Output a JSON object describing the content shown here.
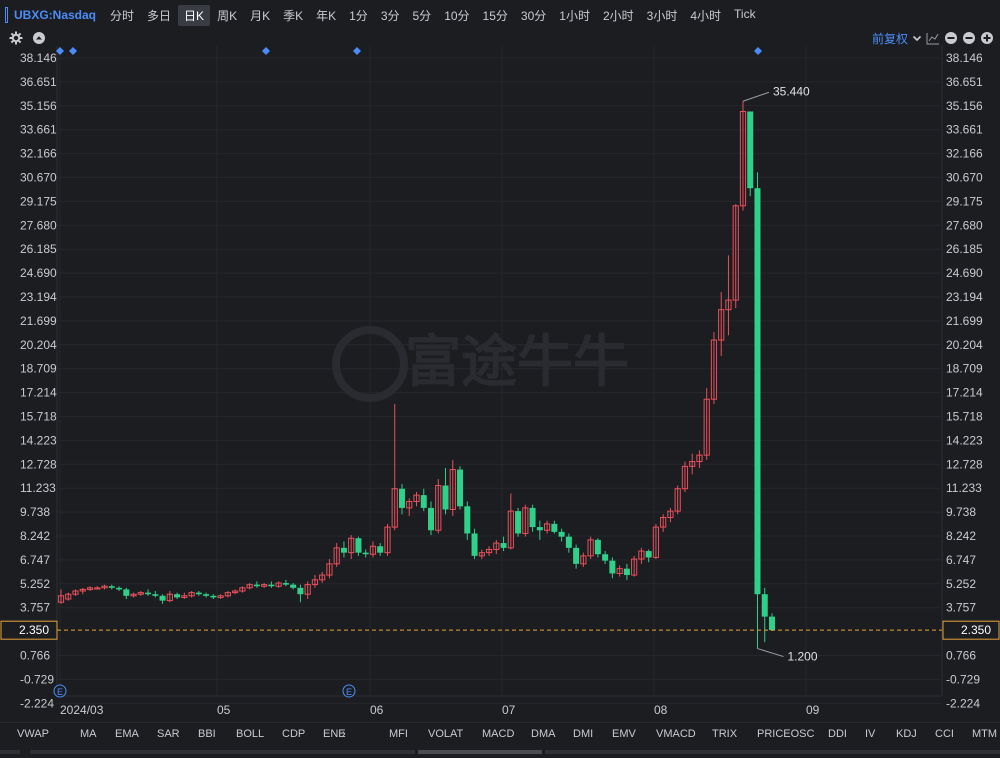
{
  "header": {
    "symbol": "UBXG:Nasdaq",
    "periods": [
      "分时",
      "多日",
      "日K",
      "周K",
      "月K",
      "季K",
      "年K",
      "1分",
      "3分",
      "5分",
      "10分",
      "15分",
      "30分",
      "1小时",
      "2小时",
      "3小时",
      "4小时",
      "Tick"
    ],
    "active_period": "日K"
  },
  "toolbar": {
    "adjust_label": "前复权"
  },
  "watermark": "富途牛牛",
  "price_axis": [
    "38.146",
    "36.651",
    "35.156",
    "33.661",
    "32.166",
    "30.670",
    "29.175",
    "27.680",
    "26.185",
    "24.690",
    "23.194",
    "21.699",
    "20.204",
    "18.709",
    "17.214",
    "15.718",
    "14.223",
    "12.728",
    "11.233",
    "9.738",
    "8.242",
    "6.747",
    "5.252",
    "3.757",
    "2.350",
    "0.766",
    "-0.729",
    "-2.224"
  ],
  "date_axis": [
    "2024/03",
    "05",
    "06",
    "07",
    "08",
    "09"
  ],
  "current_price": "2.350",
  "high_marker": "35.440",
  "low_marker": "1.200",
  "earnings_marker": "E",
  "colors": {
    "up": "#e8505b",
    "down": "#2fd08a",
    "accent": "#4b8df8",
    "price_line": "#e8a33a"
  },
  "chart_data": {
    "type": "candlestick",
    "ohlc": [
      [
        4.1,
        4.9,
        4.0,
        4.5
      ],
      [
        4.3,
        4.7,
        4.2,
        4.6
      ],
      [
        4.6,
        4.9,
        4.5,
        4.8
      ],
      [
        4.8,
        5.0,
        4.6,
        4.9
      ],
      [
        4.9,
        5.1,
        4.8,
        5.0
      ],
      [
        5.0,
        5.1,
        4.9,
        5.0
      ],
      [
        5.0,
        5.2,
        4.9,
        5.1
      ],
      [
        5.1,
        5.2,
        4.9,
        5.0
      ],
      [
        5.0,
        5.1,
        4.8,
        4.9
      ],
      [
        4.9,
        5.0,
        4.3,
        4.5
      ],
      [
        4.5,
        4.7,
        4.4,
        4.6
      ],
      [
        4.6,
        4.8,
        4.5,
        4.7
      ],
      [
        4.7,
        4.9,
        4.5,
        4.6
      ],
      [
        4.6,
        4.8,
        4.4,
        4.5
      ],
      [
        4.5,
        4.6,
        4.0,
        4.2
      ],
      [
        4.2,
        4.8,
        4.1,
        4.6
      ],
      [
        4.6,
        4.7,
        4.3,
        4.4
      ],
      [
        4.4,
        4.7,
        4.3,
        4.5
      ],
      [
        4.5,
        4.8,
        4.4,
        4.7
      ],
      [
        4.7,
        4.8,
        4.5,
        4.6
      ],
      [
        4.6,
        4.7,
        4.4,
        4.5
      ],
      [
        4.5,
        4.6,
        4.3,
        4.4
      ],
      [
        4.4,
        4.6,
        4.3,
        4.5
      ],
      [
        4.5,
        4.8,
        4.4,
        4.7
      ],
      [
        4.7,
        4.9,
        4.6,
        4.8
      ],
      [
        4.8,
        5.1,
        4.7,
        5.0
      ],
      [
        5.0,
        5.3,
        4.9,
        5.2
      ],
      [
        5.2,
        5.4,
        5.0,
        5.1
      ],
      [
        5.1,
        5.3,
        5.0,
        5.2
      ],
      [
        5.2,
        5.4,
        5.0,
        5.1
      ],
      [
        5.1,
        5.4,
        5.0,
        5.3
      ],
      [
        5.3,
        5.5,
        5.1,
        5.2
      ],
      [
        5.2,
        5.3,
        4.9,
        5.0
      ],
      [
        5.0,
        5.2,
        4.1,
        4.6
      ],
      [
        4.6,
        5.4,
        4.3,
        5.2
      ],
      [
        5.2,
        5.8,
        5.0,
        5.5
      ],
      [
        5.5,
        6.0,
        5.3,
        5.8
      ],
      [
        5.8,
        6.8,
        5.6,
        6.5
      ],
      [
        6.5,
        7.8,
        6.3,
        7.5
      ],
      [
        7.5,
        7.9,
        6.9,
        7.2
      ],
      [
        7.2,
        8.3,
        6.8,
        8.1
      ],
      [
        8.1,
        8.2,
        7.0,
        7.2
      ],
      [
        7.2,
        7.4,
        6.9,
        7.1
      ],
      [
        7.1,
        7.9,
        6.9,
        7.6
      ],
      [
        7.6,
        7.8,
        7.0,
        7.2
      ],
      [
        7.2,
        9.0,
        7.0,
        8.8
      ],
      [
        8.8,
        16.5,
        8.6,
        11.2
      ],
      [
        11.2,
        11.5,
        9.6,
        10.0
      ],
      [
        10.0,
        10.6,
        9.5,
        10.4
      ],
      [
        10.4,
        11.0,
        10.1,
        10.8
      ],
      [
        10.8,
        11.2,
        9.8,
        10.0
      ],
      [
        10.0,
        10.4,
        8.3,
        8.6
      ],
      [
        8.6,
        11.8,
        8.4,
        11.4
      ],
      [
        11.4,
        12.5,
        9.6,
        9.9
      ],
      [
        9.9,
        13.0,
        9.5,
        12.4
      ],
      [
        12.4,
        12.6,
        9.9,
        10.1
      ],
      [
        10.1,
        10.4,
        8.0,
        8.4
      ],
      [
        8.4,
        8.7,
        6.8,
        7.0
      ],
      [
        7.0,
        7.4,
        6.8,
        7.2
      ],
      [
        7.2,
        7.6,
        7.0,
        7.4
      ],
      [
        7.4,
        8.0,
        7.1,
        7.8
      ],
      [
        7.8,
        8.2,
        7.3,
        7.5
      ],
      [
        7.5,
        10.9,
        7.4,
        9.8
      ],
      [
        9.8,
        10.0,
        8.2,
        8.4
      ],
      [
        8.4,
        10.2,
        8.2,
        10.0
      ],
      [
        10.0,
        10.2,
        8.5,
        8.8
      ],
      [
        8.8,
        9.2,
        8.0,
        8.6
      ],
      [
        8.6,
        9.2,
        8.4,
        9.0
      ],
      [
        9.0,
        9.2,
        8.4,
        8.5
      ],
      [
        8.5,
        8.7,
        7.9,
        8.2
      ],
      [
        8.2,
        8.4,
        7.2,
        7.5
      ],
      [
        7.5,
        7.7,
        6.2,
        6.5
      ],
      [
        6.5,
        7.2,
        6.3,
        7.0
      ],
      [
        7.0,
        8.2,
        6.8,
        8.0
      ],
      [
        8.0,
        8.1,
        6.9,
        7.1
      ],
      [
        7.1,
        7.3,
        6.5,
        6.7
      ],
      [
        6.7,
        6.9,
        5.6,
        5.9
      ],
      [
        5.9,
        6.4,
        5.7,
        6.2
      ],
      [
        6.2,
        6.5,
        5.5,
        5.8
      ],
      [
        5.8,
        7.0,
        5.7,
        6.8
      ],
      [
        6.8,
        7.5,
        6.5,
        7.3
      ],
      [
        7.3,
        7.4,
        6.6,
        6.9
      ],
      [
        6.9,
        9.0,
        6.8,
        8.8
      ],
      [
        8.8,
        9.6,
        8.5,
        9.4
      ],
      [
        9.4,
        10.0,
        9.1,
        9.8
      ],
      [
        9.8,
        11.4,
        9.6,
        11.2
      ],
      [
        11.2,
        12.9,
        11.0,
        12.6
      ],
      [
        12.6,
        13.4,
        12.1,
        12.9
      ],
      [
        12.9,
        13.6,
        12.5,
        13.3
      ],
      [
        13.3,
        17.5,
        13.0,
        16.8
      ],
      [
        16.8,
        21.0,
        16.5,
        20.5
      ],
      [
        20.5,
        23.5,
        19.5,
        22.4
      ],
      [
        22.4,
        25.8,
        20.8,
        23.0
      ],
      [
        23.0,
        29.0,
        22.5,
        28.9
      ],
      [
        28.9,
        35.44,
        28.6,
        34.8
      ],
      [
        34.8,
        33.5,
        29.5,
        30.0
      ],
      [
        30.0,
        31.0,
        1.2,
        4.6
      ],
      [
        4.6,
        5.0,
        1.6,
        3.2
      ],
      [
        3.2,
        3.4,
        2.3,
        2.35
      ]
    ],
    "price_range": [
      -2.224,
      38.146
    ]
  },
  "indicators": [
    "VWAP",
    "MA",
    "EMA",
    "SAR",
    "BBI",
    "BOLL",
    "CDP",
    "ENE",
    "MFI",
    "VOLAT",
    "MACD",
    "DMA",
    "DMI",
    "EMV",
    "VMACD",
    "TRIX",
    "PRICEOSC",
    "DDI",
    "IV",
    "KDJ",
    "CCI",
    "MTM"
  ],
  "indicator_more": "›"
}
